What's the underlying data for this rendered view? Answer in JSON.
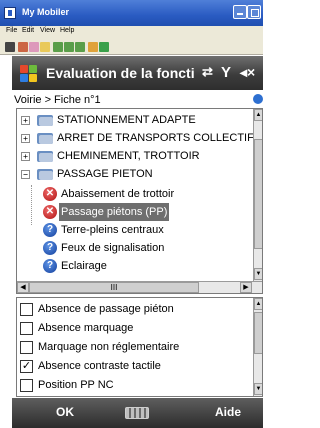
{
  "host_window": {
    "title": "My Mobiler",
    "menu": [
      "File",
      "Edit",
      "View",
      "Help"
    ],
    "toolbar_icons": [
      "stop-icon",
      "cut-icon",
      "copy-icon",
      "paste-icon",
      "capture-icon",
      "capture-icon",
      "capture-icon",
      "refresh-icon",
      "settings-icon"
    ]
  },
  "device": {
    "title": "Evaluation de la foncti",
    "status_icons": [
      "connectivity-icon",
      "signal-icon",
      "volume-icon"
    ],
    "breadcrumb": "Voirie > Fiche n°1",
    "tree": {
      "items": [
        {
          "label": "STATIONNEMENT ADAPTE",
          "expander": "+",
          "type": "folder"
        },
        {
          "label": "ARRET DE TRANSPORTS COLLECTIFS",
          "expander": "+",
          "type": "folder"
        },
        {
          "label": "CHEMINEMENT, TROTTOIR",
          "expander": "+",
          "type": "folder"
        },
        {
          "label": "PASSAGE PIETON",
          "expander": "−",
          "type": "folder"
        },
        {
          "label": "Abaissement de trottoir",
          "status": "red",
          "status_glyph": "✕"
        },
        {
          "label": "Passage piétons (PP)",
          "status": "red",
          "status_glyph": "✕",
          "selected": true
        },
        {
          "label": "Terre-pleins centraux",
          "status": "blue",
          "status_glyph": "?"
        },
        {
          "label": "Feux de signalisation",
          "status": "blue",
          "status_glyph": "?"
        },
        {
          "label": "Eclairage",
          "status": "blue",
          "status_glyph": "?"
        }
      ],
      "hscroll_thumb_glyph": "III"
    },
    "checklist": [
      {
        "label": "Absence de passage piéton",
        "checked": false
      },
      {
        "label": "Absence marquage",
        "checked": false
      },
      {
        "label": "Marquage non réglementaire",
        "checked": false
      },
      {
        "label": "Absence contraste tactile",
        "checked": true
      },
      {
        "label": "Position PP NC",
        "checked": false
      }
    ],
    "softkeys": {
      "left": "OK",
      "right": "Aide"
    }
  },
  "colors": {
    "host_title": "#2a5bc2",
    "device_bar": "#3c3c3c",
    "selected_row": "#6e6e6e",
    "status_red": "#b11212",
    "status_blue": "#133f9c"
  }
}
